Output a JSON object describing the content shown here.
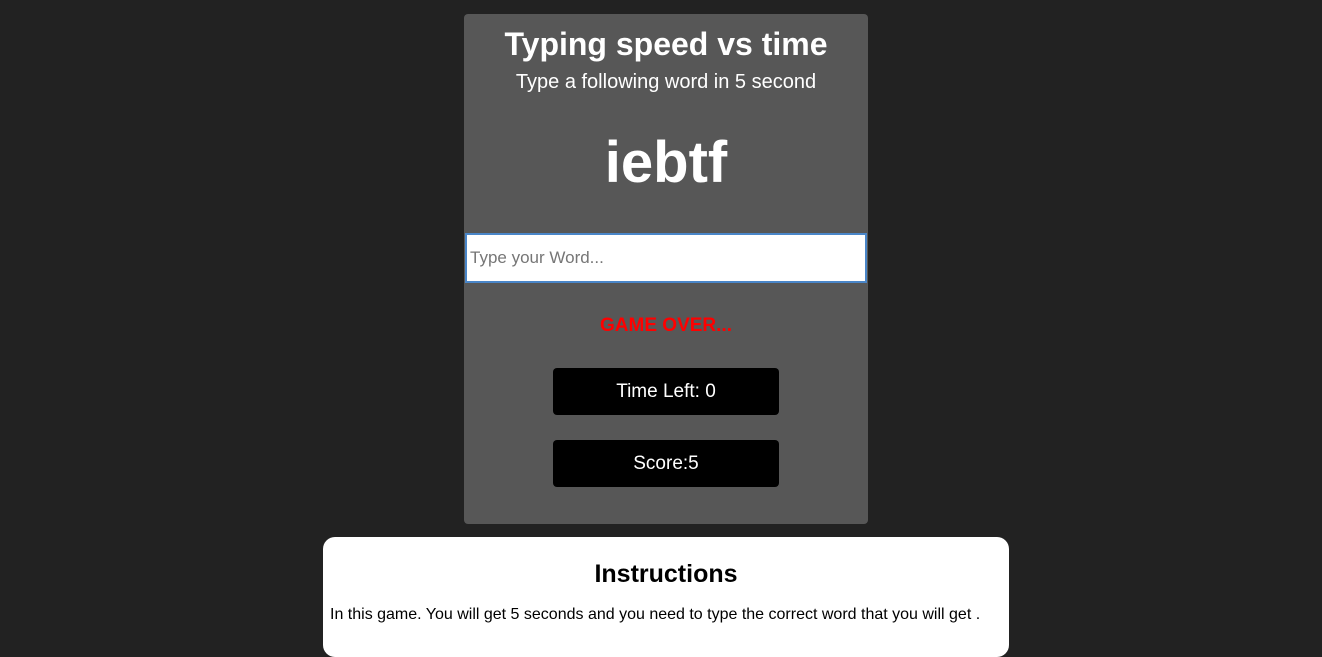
{
  "game": {
    "title": "Typing speed vs time",
    "subtitle": "Type a following word in 5 second",
    "current_word": "iebtf",
    "input_placeholder": "Type your Word...",
    "input_value": "",
    "message": "GAME OVER...",
    "time_left": "Time Left: 0",
    "score": "Score:5",
    "colors": {
      "page_background": "#222222",
      "card_background": "#575757",
      "message": "#ff0000",
      "stat_box": "#000000"
    }
  },
  "instructions": {
    "title": "Instructions",
    "text": "In this game. You will get 5 seconds and you need to type the correct word that you will get ."
  }
}
